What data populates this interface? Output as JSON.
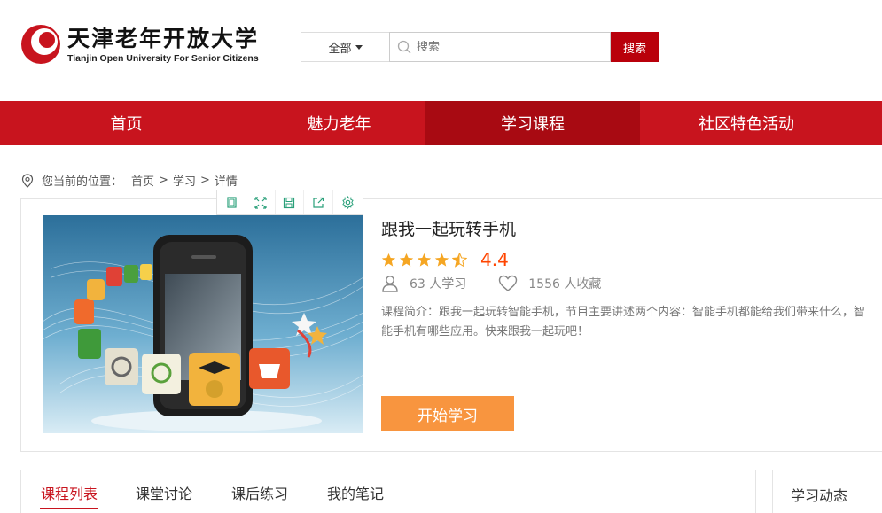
{
  "logo": {
    "name_cn": "天津老年开放大学",
    "name_en": "Tianjin Open University For Senior Citizens"
  },
  "search": {
    "category": "全部",
    "placeholder": "搜索",
    "button": "搜索"
  },
  "nav": [
    "首页",
    "魅力老年",
    "学习课程",
    "社区特色活动"
  ],
  "nav_active_index": 2,
  "breadcrumb": {
    "prefix": "您当前的位置：",
    "items": [
      "首页",
      "学习",
      "详情"
    ],
    "separator": ">"
  },
  "toolbar_icons": [
    "copy-icon",
    "fullscreen-icon",
    "save-icon",
    "share-icon",
    "settings-icon"
  ],
  "course": {
    "title": "跟我一起玩转手机",
    "rating_stars": 4.5,
    "score": "4.4",
    "learners": "63 人学习",
    "favorites": "1556 人收藏",
    "intro": "课程简介：跟我一起玩转智能手机，节目主要讲述两个内容：智能手机都能给我们带来什么，智能手机有哪些应用。快来跟我一起玩吧！",
    "start_button": "开始学习"
  },
  "tabs": [
    "课程列表",
    "课堂讨论",
    "课后练习",
    "我的笔记"
  ],
  "side_title": "学习动态",
  "colors": {
    "brand_red": "#c8141e",
    "nav_active": "#a80a12",
    "search_button": "#b9000b",
    "start_button": "#f8953f",
    "score": "#ff4500",
    "star": "#f5a623"
  }
}
